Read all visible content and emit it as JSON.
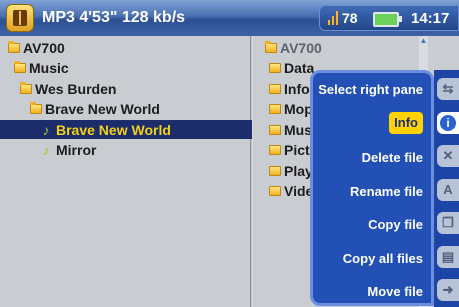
{
  "header": {
    "title": "MP3 4'53\" 128 kb/s",
    "volume": "78",
    "time": "14:17",
    "app_icon": "book-icon",
    "volume_icon": "volume-bars-icon",
    "battery_icon": "battery-icon"
  },
  "left_pane": {
    "items": [
      {
        "label": "AV700",
        "icon": "folder-icon",
        "level": 0
      },
      {
        "label": "Music",
        "icon": "folder-icon",
        "level": 1
      },
      {
        "label": "Wes Burden",
        "icon": "folder-icon",
        "level": 2
      },
      {
        "label": "Brave New World",
        "icon": "folder-icon",
        "level": 3
      },
      {
        "label": "Brave New World",
        "icon": "music-note-icon",
        "level": 4,
        "selected": true
      },
      {
        "label": "Mirror",
        "icon": "music-note-icon",
        "level": 4
      }
    ]
  },
  "right_pane": {
    "items": [
      {
        "label": "AV700"
      },
      {
        "label": "Data"
      },
      {
        "label": "Info"
      },
      {
        "label": "Moph"
      },
      {
        "label": "Musi"
      },
      {
        "label": "Pictu"
      },
      {
        "label": "Playl"
      },
      {
        "label": "Vide"
      }
    ]
  },
  "context_menu": {
    "items": [
      {
        "label": "Select right pane"
      },
      {
        "label": "Info",
        "selected": true
      },
      {
        "label": "Delete file"
      },
      {
        "label": "Rename file"
      },
      {
        "label": "Copy file"
      },
      {
        "label": "Copy all files"
      },
      {
        "label": "Move file"
      }
    ]
  },
  "side_toolbar": {
    "buttons": [
      {
        "icon": "select-pane-icon",
        "glyph": "⇆"
      },
      {
        "icon": "info-icon",
        "glyph": "i",
        "active": true
      },
      {
        "icon": "delete-icon",
        "glyph": "✕"
      },
      {
        "icon": "rename-icon",
        "glyph": "A"
      },
      {
        "icon": "copy-file-icon",
        "glyph": "❐"
      },
      {
        "icon": "copy-all-icon",
        "glyph": "▤"
      },
      {
        "icon": "move-file-icon",
        "glyph": "➜"
      }
    ]
  },
  "colors": {
    "selection_bg": "#1d2c6a",
    "selection_text": "#f2d018",
    "menu_bg": "#2250b4",
    "menu_highlight": "#ffd200"
  }
}
